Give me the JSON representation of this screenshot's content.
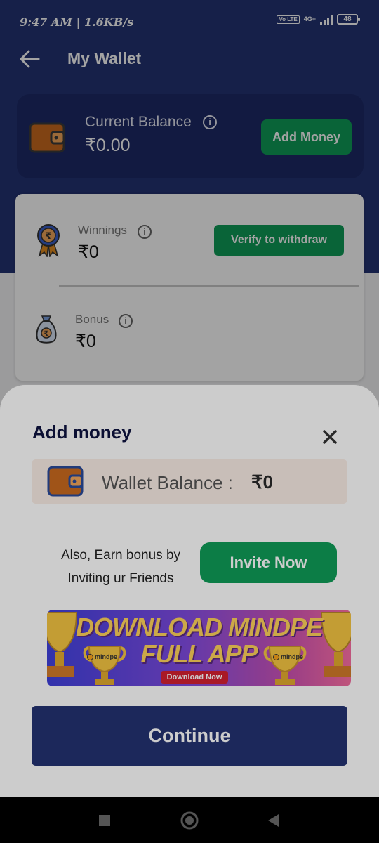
{
  "status_bar": {
    "time": "9:47 AM | 1.6KB/s",
    "volte": "Vo LTE",
    "network": "4G+",
    "battery": "48"
  },
  "header": {
    "title": "My Wallet",
    "back_icon": "arrow-left-icon"
  },
  "balance_card": {
    "label": "Current Balance",
    "value": "₹0.00",
    "add_money_label": "Add Money",
    "icon": "wallet-icon"
  },
  "winnings": {
    "label": "Winnings",
    "value": "₹0",
    "verify_label": "Verify to withdraw",
    "icon": "rupee-medal-icon"
  },
  "bonus": {
    "label": "Bonus",
    "value": "₹0",
    "icon": "money-bag-icon"
  },
  "sheet": {
    "title": "Add money",
    "close_icon": "close-icon",
    "wallet_balance_label": "Wallet Balance :",
    "wallet_balance_value": "₹0",
    "bonus_text_line1": "Also, Earn bonus by",
    "bonus_text_line2": "Inviting ur Friends",
    "invite_label": "Invite Now",
    "banner": {
      "line1": "DOWNLOAD MINDPE",
      "line2": "FULL APP",
      "cta": "Download Now",
      "logo_text": "mindpe"
    },
    "continue_label": "Continue"
  },
  "nav_bar": {
    "recents_icon": "square-icon",
    "home_icon": "circle-icon",
    "back_icon": "triangle-back-icon"
  },
  "colors": {
    "primary": "#233272",
    "green": "#0f9d58",
    "wallet_orange": "#c86a1e"
  }
}
